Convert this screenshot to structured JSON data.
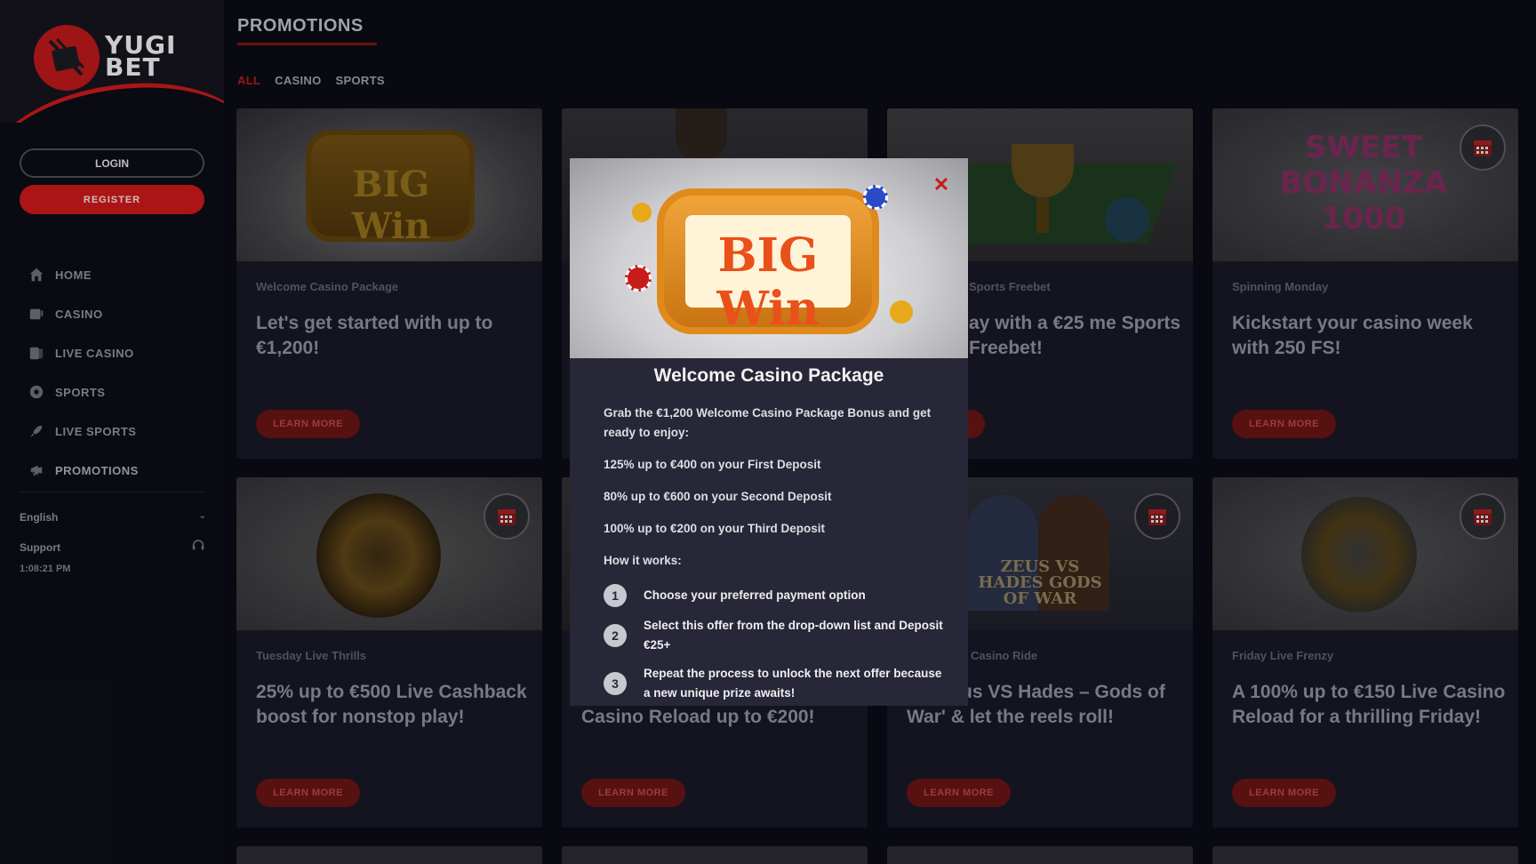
{
  "brand": {
    "logo_line1": "YUGI",
    "logo_line2": "BET",
    "accent": "#c41818"
  },
  "sidebar": {
    "login_label": "LOGIN",
    "register_label": "REGISTER",
    "items": [
      {
        "label": "HOME",
        "icon": "home-icon"
      },
      {
        "label": "CASINO",
        "icon": "slot-machine-icon"
      },
      {
        "label": "LIVE CASINO",
        "icon": "live-cards-icon"
      },
      {
        "label": "SPORTS",
        "icon": "soccer-ball-icon"
      },
      {
        "label": "LIVE SPORTS",
        "icon": "rocket-icon"
      },
      {
        "label": "PROMOTIONS",
        "icon": "megaphone-icon"
      }
    ],
    "language": "English",
    "support_label": "Support",
    "time": "1:08:21 PM"
  },
  "main": {
    "title": "PROMOTIONS",
    "filters": [
      "ALL",
      "CASINO",
      "SPORTS"
    ],
    "active_filter": "ALL",
    "cards": [
      {
        "category": "Welcome Casino Package",
        "headline": "Let's get started with up to €1,200!",
        "button": "LEARN MORE"
      },
      {
        "category": "",
        "headline": "",
        "button": ""
      },
      {
        "category": "Sports Freebet",
        "headline": "ay with a €25 me Sports Freebet!",
        "button": "ORE"
      },
      {
        "category": "Spinning Monday",
        "headline": "Kickstart your casino week with 250 FS!",
        "button": "LEARN MORE"
      },
      {
        "category": "Tuesday Live Thrills",
        "headline": "25% up to €500 Live Cashback boost for nonstop play!",
        "button": "LEARN MORE"
      },
      {
        "category": "",
        "headline": "Casino Reload up to €200!",
        "button": "LEARN MORE"
      },
      {
        "category": "Casino Ride",
        "headline": "on 'Zeus VS Hades – Gods of War' & let the reels roll!",
        "button": "LEARN MORE"
      },
      {
        "category": "Friday Live Frenzy",
        "headline": "A 100% up to €150 Live Casino Reload for a thrilling Friday!",
        "button": "LEARN MORE"
      }
    ]
  },
  "modal": {
    "title": "Welcome Casino Package",
    "intro": "Grab the €1,200 Welcome Casino Package Bonus and get ready to enjoy:",
    "deposit1": "125% up to €400 on your First Deposit",
    "deposit2": "80% up to €600 on your Second Deposit",
    "deposit3": "100% up to €200 on your Third Deposit",
    "how_it_works": "How it works:",
    "steps": [
      {
        "num": "1",
        "text": "Choose your preferred payment option"
      },
      {
        "num": "2",
        "text": "Select this offer from the drop-down list and Deposit €25+"
      },
      {
        "num": "3",
        "text": "Repeat the process to unlock the next offer because a new unique prize awaits!"
      }
    ],
    "close_icon": "close-icon"
  },
  "images": {
    "big_win_art": "BIG Win",
    "sweet_bonanza": "SWEET BONANZA 1000",
    "zeus_hades": "ZEUS VS HADES GODS OF WAR"
  }
}
